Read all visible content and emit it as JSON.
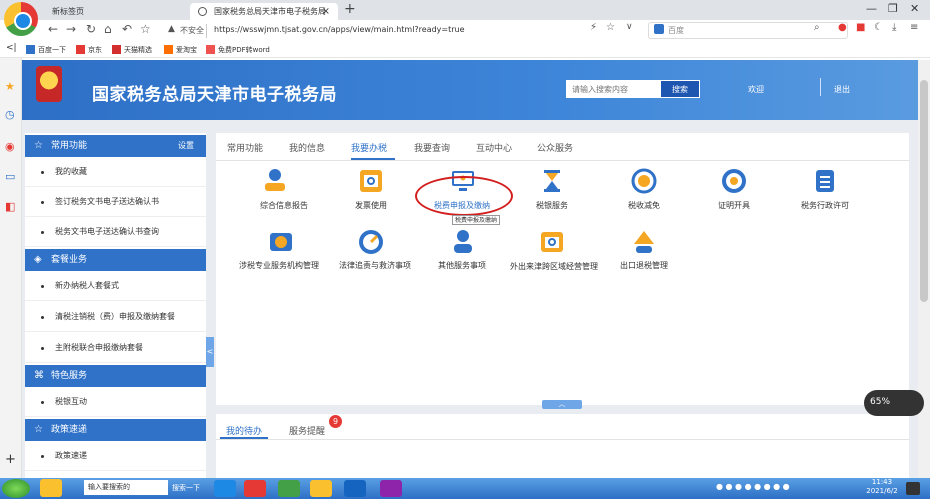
{
  "browser": {
    "tabs": [
      {
        "label": "新标签页"
      },
      {
        "label": "国家税务总局天津市电子税务局"
      }
    ],
    "security": "不安全",
    "url": "https://wsswjmn.tjsat.gov.cn/apps/view/main.html?ready=true",
    "search_engine": "百度",
    "bookmarks": [
      "百度一下",
      "京东",
      "天猫精选",
      "爱淘宝",
      "免费PDF转word"
    ]
  },
  "header": {
    "title": "国家税务总局天津市电子税务局",
    "search_placeholder": "请输入搜索内容",
    "search_button": "搜索",
    "welcome": "欢迎",
    "logout": "退出"
  },
  "sidebar": {
    "sections": [
      {
        "title": "常用功能",
        "extra": "设置",
        "items": [
          "我的收藏",
          "签订税务文书电子送达确认书",
          "税务文书电子送达确认书查询"
        ]
      },
      {
        "title": "套餐业务",
        "items": [
          "新办纳税人套餐式",
          "清税注销税（费）申报及缴纳套餐",
          "主附税联合申报缴纳套餐"
        ]
      },
      {
        "title": "特色服务",
        "items": [
          "税银互动"
        ]
      },
      {
        "title": "政策速递",
        "items": [
          "政策速递"
        ]
      }
    ]
  },
  "main": {
    "tabs": [
      "常用功能",
      "我的信息",
      "我要办税",
      "我要查询",
      "互动中心",
      "公众服务"
    ],
    "active_tab": "我要办税",
    "services": [
      {
        "label": "综合信息报告",
        "icon": "user-badge-icon"
      },
      {
        "label": "发票使用",
        "icon": "invoice-icon"
      },
      {
        "label": "税费申报及缴纳",
        "icon": "monitor-icon"
      },
      {
        "label": "税银服务",
        "icon": "hourglass-icon"
      },
      {
        "label": "税收减免",
        "icon": "refresh-yuan-icon"
      },
      {
        "label": "证明开具",
        "icon": "compass-icon"
      },
      {
        "label": "税务行政许可",
        "icon": "document-list-icon"
      },
      {
        "label": "涉税专业服务机构管理",
        "icon": "yuan-box-icon"
      },
      {
        "label": "法律追责与救济事项",
        "icon": "gauge-icon"
      },
      {
        "label": "其他服务事项",
        "icon": "person-icon"
      },
      {
        "label": "外出来津跨区域经营管理",
        "icon": "id-card-icon"
      },
      {
        "label": "出口退税管理",
        "icon": "warning-person-icon"
      }
    ],
    "tooltip": "税费申报及缴纳"
  },
  "lower": {
    "tabs": [
      "我的待办",
      "服务提醒"
    ],
    "badge": "9"
  },
  "widget": {
    "value": "65%"
  },
  "taskbar": {
    "input": "输入要搜索的",
    "search": "搜索一下",
    "time": "11:43",
    "date": "2021/6/2"
  },
  "colors": {
    "primary": "#2f72c8",
    "accent": "#e53935",
    "orange": "#f5a623"
  }
}
